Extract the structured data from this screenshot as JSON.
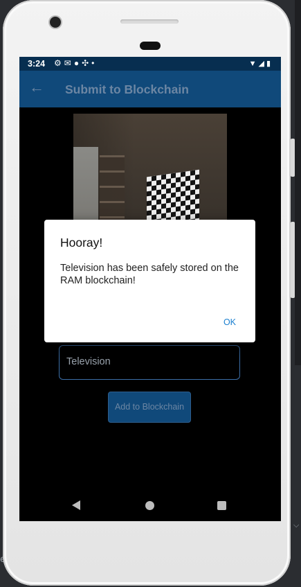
{
  "status_bar": {
    "time": "3:24",
    "left_icons": [
      "gear-icon",
      "mail-icon",
      "globe-icon",
      "sync-icon",
      "dot-icon"
    ],
    "right_icons": [
      "wifi-icon",
      "signal-icon",
      "battery-icon"
    ]
  },
  "app_bar": {
    "title": "Submit to Blockchain"
  },
  "form": {
    "item_name_value": "Television",
    "submit_label": "Add to Blockchain"
  },
  "dialog": {
    "title": "Hooray!",
    "message": "Television has been safely stored on the RAM blockchain!",
    "ok_label": "OK"
  },
  "colors": {
    "status_bar": "#072e50",
    "app_bar": "#10497a",
    "input_border": "#3c6fa8",
    "ok_button": "#1a7fcf"
  }
}
